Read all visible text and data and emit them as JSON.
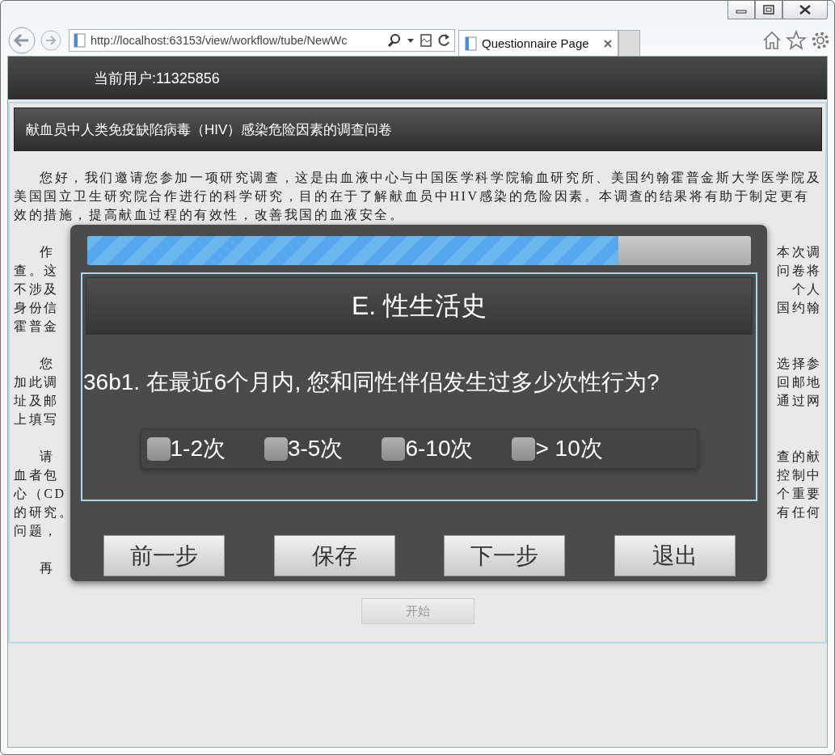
{
  "browser": {
    "address": "http://localhost:63153/view/workflow/tube/NewWc",
    "tabs": [
      {
        "title": "Questionnaire Page",
        "selected": true
      }
    ]
  },
  "user_bar": {
    "label": "当前用户:11325856"
  },
  "page": {
    "title": "献血员中人类免疫缺陷病毒（HIV）感染危险因素的调查问卷",
    "intro": "您好，我们邀请您参加一项研究调查，这是由血液中心与中国医学科学院输血研究所、美国约翰霍普金斯大学医学院及美国国立卫生研究院合作进行的科学研究，目的在于了解献血员中HIV感染的危险因素。本调查的结果将有助于制定更有效的措施，提高献血过程的有效性，改善我国的血液安全。",
    "covered_paragraphs": [
      [
        {
          "left": "作",
          "right": "本次调"
        },
        {
          "left": "查。这",
          "right": "问卷将"
        },
        {
          "left": "不涉及",
          "right": "个人"
        },
        {
          "left": "身份信",
          "right": "国约翰"
        },
        {
          "left": "霍普金"
        }
      ],
      [
        {
          "left": "您",
          "right": "选择参"
        },
        {
          "left": "加此调",
          "right": "回邮地"
        },
        {
          "left": "址及邮",
          "right": "通过网"
        },
        {
          "left": "上填写"
        }
      ],
      [
        {
          "left": "请",
          "right": "查的献"
        },
        {
          "left": "血者包",
          "right": "控制中"
        },
        {
          "left": "心（CD",
          "right": "个重要"
        },
        {
          "left": "的研究。",
          "right": "有任何"
        },
        {
          "left": "问题，"
        }
      ],
      [
        {
          "left": "再"
        }
      ]
    ],
    "start_button": {
      "label": "开始",
      "disabled": true
    }
  },
  "dialog": {
    "progress": {
      "level": 0.8
    },
    "section_title": "E. 性生活史",
    "question": "36b1. 在最近6个月内, 您和同性伴侣发生过多少次性行为?",
    "options": [
      {
        "label": "1-2次",
        "checked": false
      },
      {
        "label": "3-5次",
        "checked": false
      },
      {
        "label": "6-10次",
        "checked": false
      },
      {
        "label": "> 10次",
        "checked": false
      }
    ],
    "buttons": [
      "前一步",
      "保存",
      "下一步",
      "退出"
    ]
  }
}
